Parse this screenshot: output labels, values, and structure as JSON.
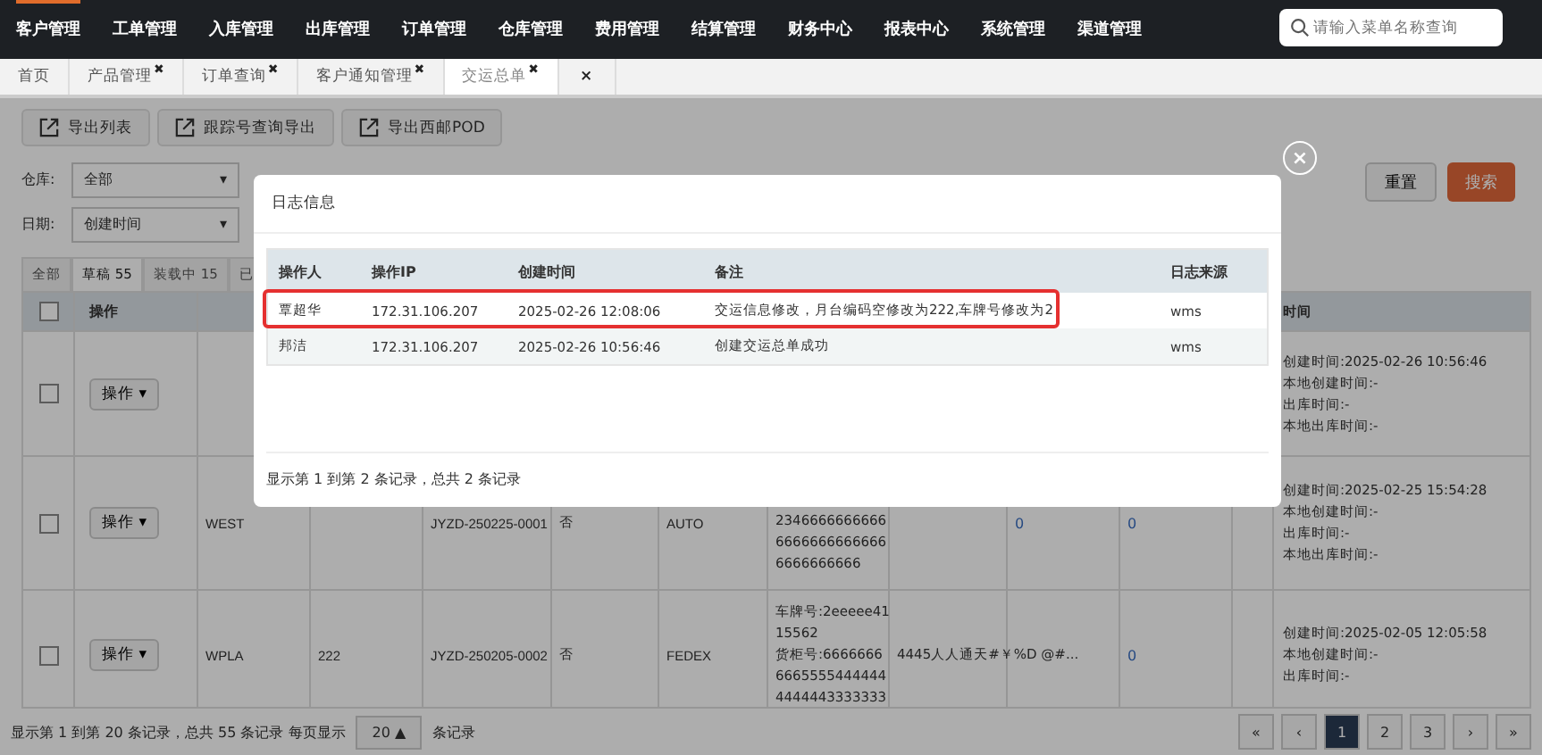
{
  "nav": {
    "items": [
      {
        "label": "客户管理",
        "selected": true
      },
      {
        "label": "工单管理",
        "selected": false
      },
      {
        "label": "入库管理",
        "selected": false
      },
      {
        "label": "出库管理",
        "selected": false
      },
      {
        "label": "订单管理",
        "selected": false
      },
      {
        "label": "仓库管理",
        "selected": false
      },
      {
        "label": "费用管理",
        "selected": false
      },
      {
        "label": "结算管理",
        "selected": false
      },
      {
        "label": "财务中心",
        "selected": false
      },
      {
        "label": "报表中心",
        "selected": false
      },
      {
        "label": "系统管理",
        "selected": false
      },
      {
        "label": "渠道管理",
        "selected": false
      }
    ],
    "search": {
      "placeholder": "请输入菜单名称查询"
    }
  },
  "page_tabs": [
    {
      "label": "首页",
      "selected": false
    },
    {
      "label": "产品管理",
      "close": "✖",
      "selected": false
    },
    {
      "label": "订单查询",
      "close": "✖",
      "selected": false
    },
    {
      "label": "客户通知管理",
      "close": "✖",
      "selected": false
    },
    {
      "label": "交运总单",
      "close": "✖",
      "selected": true
    }
  ],
  "close_all": "×",
  "toolbar": [
    "导出列表",
    "跟踪号查询导出",
    "导出西邮POD"
  ],
  "filters": [
    {
      "label": "仓库:",
      "value": "全部",
      "caret": "▾"
    },
    {
      "label": "日期:",
      "value": "创建时间",
      "caret": "▾"
    }
  ],
  "reset_button": "重置",
  "search_button": "搜索",
  "status_tabs": [
    {
      "label": "全部",
      "selected": false
    },
    {
      "label": "草稿 55",
      "selected": true
    },
    {
      "label": "装载中 15",
      "selected": false
    },
    {
      "label": "已",
      "selected": false
    }
  ],
  "table": {
    "columns": [
      "操作",
      "时间"
    ],
    "all_checked": false,
    "rows": [
      {
        "checked": false,
        "action": "操作 ▾",
        "times": [
          "创建时间:2025-02-26 10:56:46",
          "本地创建时间:-",
          "出库时间:-",
          "本地出库时间:-"
        ]
      },
      {
        "checked": false,
        "action": "操作 ▾",
        "warehouse": "WEST",
        "order": "JYZD-250225-0001",
        "flag": "否",
        "carrier": "AUTO",
        "tracking": [
          "2346666666666",
          "6666666666666",
          "6666666666"
        ],
        "count_a": "0",
        "count_b": "0",
        "times": [
          "创建时间:2025-02-25 15:54:28",
          "本地创建时间:-",
          "出库时间:-",
          "本地出库时间:-"
        ]
      },
      {
        "checked": false,
        "action": "操作 ▾",
        "warehouse": "WPLA",
        "number": "222",
        "order": "JYZD-250205-0002",
        "flag": "否",
        "carrier": "FEDEX",
        "tracking": [
          "车牌号:2eeeee41",
          "15562",
          "货柜号:6666666",
          "6665555444444",
          "4444443333333"
        ],
        "remark": "4445人人通天#￥%D @#...",
        "count_b": "0",
        "times": [
          "创建时间:2025-02-05 12:05:58",
          "本地创建时间:-",
          "出库时间:-"
        ]
      }
    ]
  },
  "pagination": {
    "summary": "显示第 1 到第 20 条记录，总共 55 条记录 每页显示",
    "page_size": "20 ▲",
    "suffix": "条记录",
    "pages": [
      {
        "label": "«",
        "selected": false
      },
      {
        "label": "‹",
        "selected": false
      },
      {
        "label": "1",
        "selected": true
      },
      {
        "label": "2",
        "selected": false
      },
      {
        "label": "3",
        "selected": false
      },
      {
        "label": "›",
        "selected": false
      },
      {
        "label": "»",
        "selected": false
      }
    ]
  },
  "modal": {
    "title": "日志信息",
    "close": "×",
    "columns": [
      "操作人",
      "操作IP",
      "创建时间",
      "备注",
      "日志来源"
    ],
    "rows": [
      {
        "cells": [
          "覃超华",
          "172.31.106.207",
          "2025-02-26 12:08:06",
          "交运信息修改，月台编码空修改为222,车牌号修改为2",
          "wms"
        ],
        "highlighted": true
      },
      {
        "cells": [
          "邦洁",
          "172.31.106.207",
          "2025-02-26 10:56:46",
          "创建交运总单成功",
          "wms"
        ],
        "highlighted": false
      }
    ],
    "footer": "显示第 1 到第 2 条记录，总共 2 条记录"
  }
}
